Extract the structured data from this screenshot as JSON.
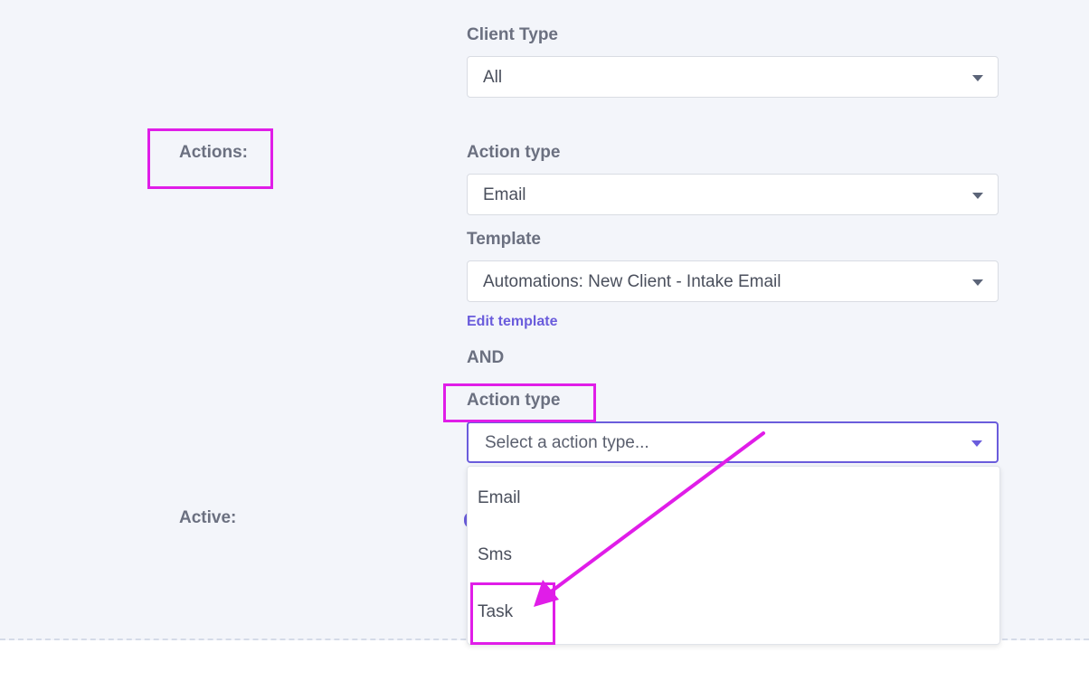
{
  "client_type": {
    "label": "Client Type",
    "value": "All"
  },
  "actions": {
    "row_label": "Actions:",
    "first": {
      "action_type_label": "Action type",
      "action_type_value": "Email",
      "template_label": "Template",
      "template_value": "Automations: New Client - Intake Email",
      "edit_link": "Edit template"
    },
    "conjunction": "AND",
    "second": {
      "action_type_label": "Action type",
      "placeholder": "Select a action type...",
      "options": [
        "Email",
        "Sms",
        "Task"
      ]
    }
  },
  "active": {
    "row_label": "Active:"
  },
  "colors": {
    "accent": "#6a5cdc",
    "annotation": "#e01de8",
    "panel_bg": "#f3f5fa"
  }
}
